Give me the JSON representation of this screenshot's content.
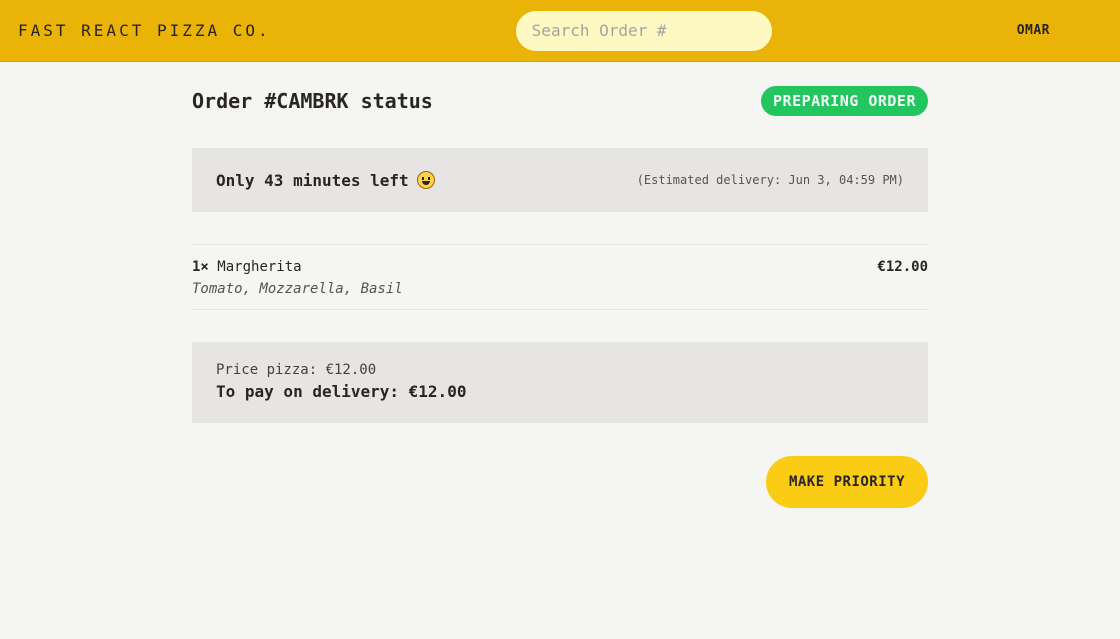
{
  "header": {
    "logo": "FAST REACT PIZZA CO.",
    "search_placeholder": "Search Order #",
    "search_value": "",
    "username": "OMAR"
  },
  "order": {
    "title": "Order #CAMBRK status",
    "status_badge": "PREPARING ORDER",
    "time_left": "Only 43 minutes left",
    "estimated_delivery": "(Estimated delivery: Jun 3, 04:59 PM)",
    "items": [
      {
        "qty": "1×",
        "name": "Margherita",
        "price": "€12.00",
        "ingredients": "Tomato, Mozzarella, Basil"
      }
    ],
    "price_pizza": "Price pizza: €12.00",
    "to_pay": "To pay on delivery: €12.00",
    "make_priority_label": "MAKE PRIORITY"
  },
  "icons": {
    "eta": "smiley-emoji-icon"
  },
  "colors": {
    "header_bg": "#eab308",
    "badge_bg": "#22c55e",
    "button_bg": "#facc15",
    "panel_bg": "#e7e5e4"
  }
}
